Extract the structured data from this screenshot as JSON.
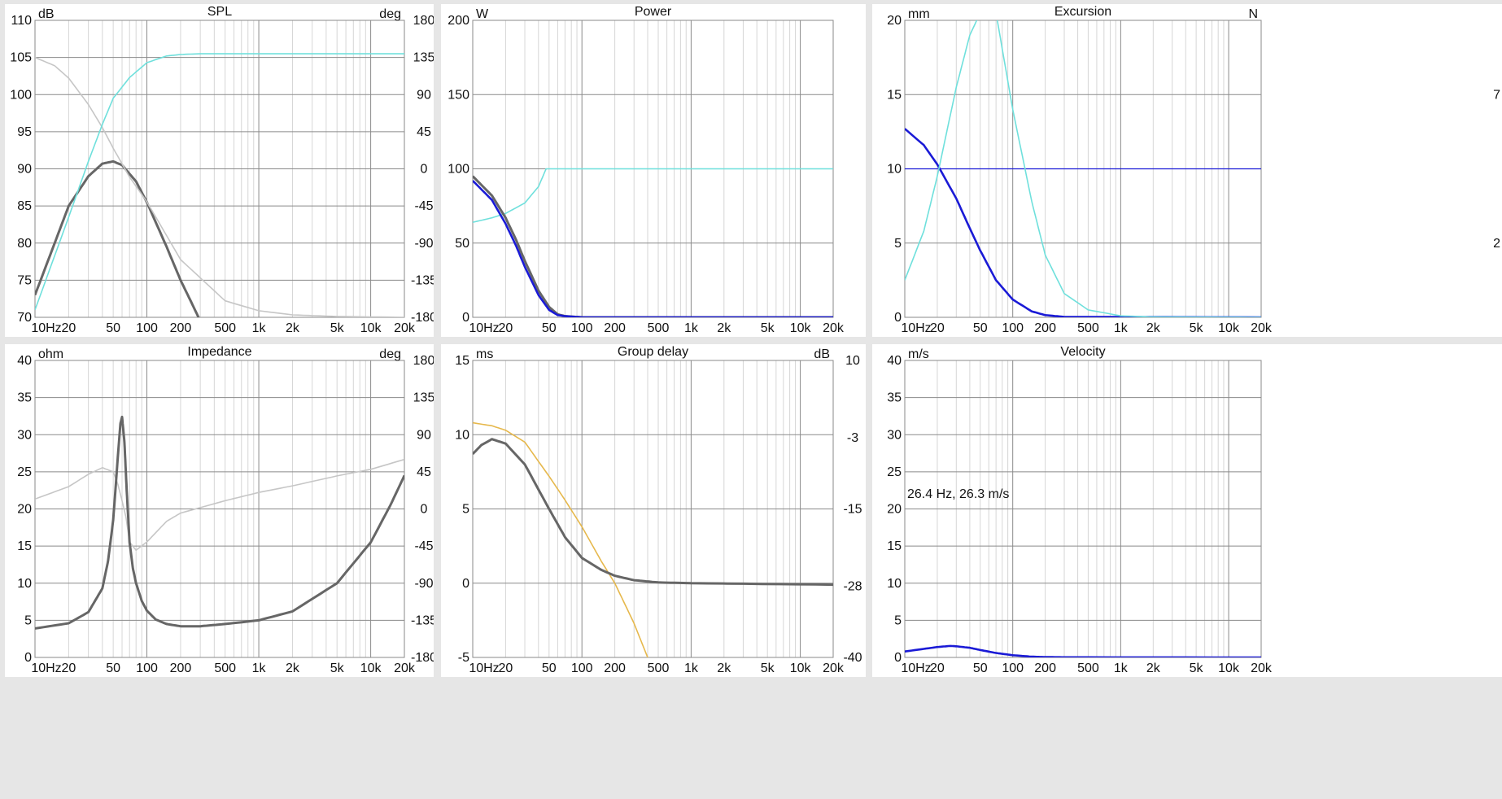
{
  "colors": {
    "background": "#e6e6e6",
    "panel": "#ffffff",
    "grid_major": "#8a8a8a",
    "grid_minor": "#d6d6d6",
    "dark_gray": "#666666",
    "light_gray": "#c6c6c6",
    "cyan": "#6fe0dc",
    "blue": "#1a1ad6",
    "gold": "#e6b84c"
  },
  "x_tick_labels": [
    "10Hz",
    "20",
    "50",
    "100",
    "200",
    "500",
    "1k",
    "2k",
    "5k",
    "10k",
    "20k"
  ],
  "chart_data": [
    {
      "type": "line",
      "title": "SPL",
      "scale_x": "log",
      "xlim": [
        10,
        20000
      ],
      "left_unit": "dB",
      "right_unit": "deg",
      "ylim": [
        70,
        110
      ],
      "y_ticks": [
        70,
        75,
        80,
        85,
        90,
        95,
        100,
        105,
        110
      ],
      "y2lim": [
        -180,
        180
      ],
      "y2_ticks": [
        -180,
        -135,
        -90,
        -45,
        0,
        45,
        90,
        135,
        180
      ],
      "series": [
        {
          "color": "dark_gray",
          "width": 3,
          "axis": "left",
          "x": [
            10,
            15,
            20,
            30,
            40,
            50,
            60,
            80,
            100,
            150,
            200,
            250,
            300
          ],
          "y": [
            73,
            80,
            85,
            89,
            90.7,
            91,
            90.5,
            88.3,
            85.5,
            79.5,
            75,
            72,
            69.5
          ]
        },
        {
          "color": "light_gray",
          "width": 1.6,
          "axis": "right",
          "x": [
            10,
            15,
            20,
            30,
            40,
            50,
            70,
            100,
            200,
            500,
            1000,
            2000,
            5000,
            20000
          ],
          "y": [
            135,
            125,
            110,
            78,
            50,
            25,
            -10,
            -40,
            -110,
            -160,
            -172,
            -177,
            -179,
            -180
          ]
        },
        {
          "color": "cyan",
          "width": 1.6,
          "axis": "left",
          "x": [
            10,
            20,
            30,
            40,
            50,
            70,
            100,
            150,
            200,
            300,
            500,
            1000,
            20000
          ],
          "y": [
            71,
            83.5,
            91,
            96,
            99.5,
            102.3,
            104.3,
            105.2,
            105.4,
            105.5,
            105.5,
            105.5,
            105.5
          ]
        }
      ]
    },
    {
      "type": "line",
      "title": "Power",
      "scale_x": "log",
      "xlim": [
        10,
        20000
      ],
      "left_unit": "W",
      "right_unit": "",
      "ylim": [
        0,
        200
      ],
      "y_ticks": [
        0,
        50,
        100,
        150,
        200
      ],
      "series": [
        {
          "color": "cyan",
          "width": 1.6,
          "axis": "left",
          "x": [
            10,
            15,
            20,
            30,
            40,
            47,
            50,
            100,
            1000,
            20000
          ],
          "y": [
            64,
            67,
            70,
            77,
            88,
            100,
            100,
            100,
            100,
            100
          ]
        },
        {
          "color": "dark_gray",
          "width": 3,
          "axis": "left",
          "x": [
            10,
            15,
            20,
            25,
            30,
            40,
            50,
            60,
            70,
            100,
            20000
          ],
          "y": [
            95,
            82,
            67,
            52,
            38,
            18,
            7,
            2,
            0.8,
            0,
            0
          ]
        },
        {
          "color": "blue",
          "width": 2.6,
          "axis": "left",
          "x": [
            10,
            15,
            20,
            25,
            30,
            40,
            50,
            60,
            70,
            100,
            20000
          ],
          "y": [
            92,
            79,
            63,
            48,
            34,
            15,
            5,
            1.5,
            0.8,
            0,
            0
          ]
        }
      ]
    },
    {
      "type": "line",
      "title": "Excursion",
      "scale_x": "log",
      "xlim": [
        10,
        20000
      ],
      "left_unit": "mm",
      "right_unit": "N",
      "right_unit_visible_ticks": [
        "7",
        "2"
      ],
      "ylim": [
        0,
        20
      ],
      "y_ticks": [
        0,
        5,
        10,
        15,
        20
      ],
      "series": [
        {
          "color": "blue",
          "width": 1.3,
          "axis": "left",
          "x": [
            10,
            20000
          ],
          "y": [
            10,
            10
          ]
        },
        {
          "color": "blue",
          "width": 2.6,
          "axis": "left",
          "x": [
            10,
            15,
            20,
            30,
            40,
            50,
            70,
            100,
            150,
            200,
            300,
            20000
          ],
          "y": [
            12.7,
            11.6,
            10.3,
            8,
            6,
            4.5,
            2.5,
            1.2,
            0.4,
            0.15,
            0.03,
            0
          ]
        },
        {
          "color": "cyan",
          "width": 1.6,
          "axis": "left",
          "x": [
            10,
            15,
            20,
            30,
            40,
            50,
            60,
            70,
            100,
            150,
            200,
            300,
            500,
            1000,
            2000,
            20000
          ],
          "y": [
            2.5,
            5.8,
            9.5,
            15.5,
            19,
            20.5,
            21,
            20.5,
            14,
            7.8,
            4.2,
            1.6,
            0.5,
            0.1,
            0.02,
            0
          ]
        }
      ]
    },
    {
      "type": "line",
      "title": "Impedance",
      "scale_x": "log",
      "xlim": [
        10,
        20000
      ],
      "left_unit": "ohm",
      "right_unit": "deg",
      "ylim": [
        0,
        40
      ],
      "y_ticks": [
        0,
        5,
        10,
        15,
        20,
        25,
        30,
        35,
        40
      ],
      "y2lim": [
        -180,
        180
      ],
      "y2_ticks": [
        -180,
        -135,
        -90,
        -45,
        0,
        45,
        90,
        135,
        180
      ],
      "series": [
        {
          "color": "light_gray",
          "width": 1.6,
          "axis": "right",
          "x": [
            10,
            20,
            30,
            40,
            50,
            55,
            60,
            65,
            70,
            80,
            100,
            150,
            200,
            500,
            1000,
            2000,
            5000,
            10000,
            20000
          ],
          "y": [
            12,
            27,
            42,
            50,
            45,
            30,
            10,
            -10,
            -40,
            -50,
            -40,
            -15,
            -5,
            10,
            20,
            28,
            40,
            48,
            60
          ]
        },
        {
          "color": "dark_gray",
          "width": 3,
          "axis": "left",
          "x": [
            10,
            20,
            30,
            40,
            45,
            50,
            55,
            58,
            60,
            63,
            66,
            70,
            75,
            80,
            90,
            100,
            120,
            150,
            200,
            300,
            500,
            1000,
            2000,
            5000,
            10000,
            15000,
            20000
          ],
          "y": [
            3.9,
            4.6,
            6.1,
            9.3,
            13,
            18.5,
            27,
            31.5,
            32.4,
            29,
            22.5,
            15.5,
            12,
            10,
            7.6,
            6.3,
            5.1,
            4.5,
            4.2,
            4.2,
            4.5,
            5,
            6.2,
            10,
            15.5,
            20.5,
            24.5
          ]
        }
      ]
    },
    {
      "type": "line",
      "title": "Group delay",
      "scale_x": "log",
      "xlim": [
        10,
        20000
      ],
      "left_unit": "ms",
      "right_unit": "dB",
      "ylim": [
        -5,
        15
      ],
      "y_ticks": [
        -5,
        0,
        5,
        10,
        15
      ],
      "y2lim": [
        -40,
        10
      ],
      "y2_ticks": [
        -40,
        -28,
        -15,
        -3,
        10
      ],
      "series": [
        {
          "color": "gold",
          "width": 1.6,
          "axis": "left",
          "x": [
            10,
            15,
            20,
            30,
            50,
            70,
            100,
            150,
            200,
            300,
            400
          ],
          "y": [
            10.8,
            10.6,
            10.3,
            9.5,
            7.2,
            5.6,
            3.8,
            1.5,
            0,
            -2.7,
            -5
          ]
        },
        {
          "color": "dark_gray",
          "width": 3,
          "axis": "left",
          "x": [
            10,
            12,
            15,
            20,
            30,
            50,
            70,
            100,
            150,
            200,
            300,
            500,
            1000,
            20000
          ],
          "y": [
            8.7,
            9.3,
            9.7,
            9.4,
            8,
            5,
            3.1,
            1.7,
            0.9,
            0.5,
            0.2,
            0.05,
            0,
            -0.1
          ]
        }
      ]
    },
    {
      "type": "line",
      "title": "Velocity",
      "scale_x": "log",
      "xlim": [
        10,
        20000
      ],
      "left_unit": "m/s",
      "right_unit": "",
      "ylim": [
        0,
        40
      ],
      "y_ticks": [
        0,
        5,
        10,
        15,
        20,
        25,
        30,
        35,
        40
      ],
      "annotation": "26.4 Hz, 26.3 m/s",
      "series": [
        {
          "color": "blue",
          "width": 2.6,
          "axis": "left",
          "x": [
            10,
            15,
            20,
            26.4,
            30,
            40,
            50,
            70,
            100,
            150,
            200,
            300,
            20000
          ],
          "y": [
            0.8,
            1.15,
            1.4,
            1.55,
            1.5,
            1.3,
            1,
            0.6,
            0.3,
            0.1,
            0.05,
            0.02,
            0
          ]
        }
      ]
    }
  ]
}
